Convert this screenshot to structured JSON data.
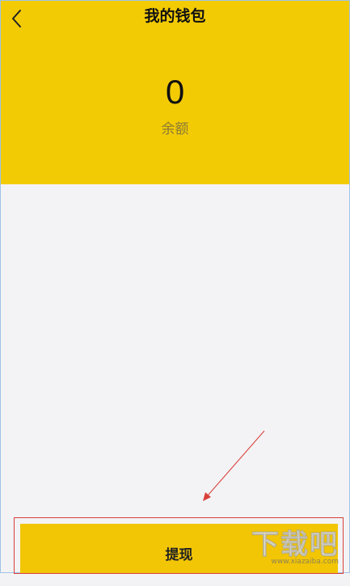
{
  "header": {
    "title": "我的钱包",
    "back_icon": "chevron-left-icon"
  },
  "wallet": {
    "balance_value": "0",
    "balance_label": "余额"
  },
  "actions": {
    "withdraw_label": "提现"
  },
  "watermark": {
    "main": "下载吧",
    "sub": "www.xiazaiba.com"
  },
  "colors": {
    "header_bg": "#f3cb05",
    "button_bg": "#f2c505",
    "page_bg": "#f3f3f5",
    "annotation": "#d9403a"
  }
}
